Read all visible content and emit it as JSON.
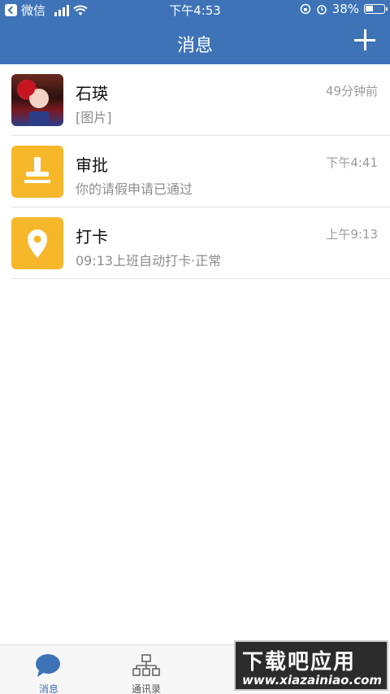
{
  "status_bar": {
    "carrier": "微信",
    "time": "下午4:53",
    "battery": "38%"
  },
  "header": {
    "title": "消息",
    "add_icon": "plus-icon"
  },
  "conversations": [
    {
      "name": "石瑛",
      "preview": "[图片]",
      "time": "49分钟前",
      "avatar": "user-photo"
    },
    {
      "name": "审批",
      "preview": "你的请假申请已通过",
      "time": "下午4:41",
      "avatar": "stamp-icon",
      "avatar_color": "#f6b72a"
    },
    {
      "name": "打卡",
      "preview": "09:13上班自动打卡·正常",
      "time": "上午9:13",
      "avatar": "location-pin-icon",
      "avatar_color": "#f6b72a"
    }
  ],
  "tabbar": {
    "tabs": [
      {
        "label": "消息",
        "icon": "chat-bubble-icon",
        "active": true
      },
      {
        "label": "通讯录",
        "icon": "org-chart-icon",
        "active": false
      }
    ]
  },
  "watermark": {
    "line1": "下载吧应用",
    "line2": "www.xiazainiao.com"
  },
  "colors": {
    "primary": "#3e73b8",
    "accent": "#f6b72a"
  }
}
